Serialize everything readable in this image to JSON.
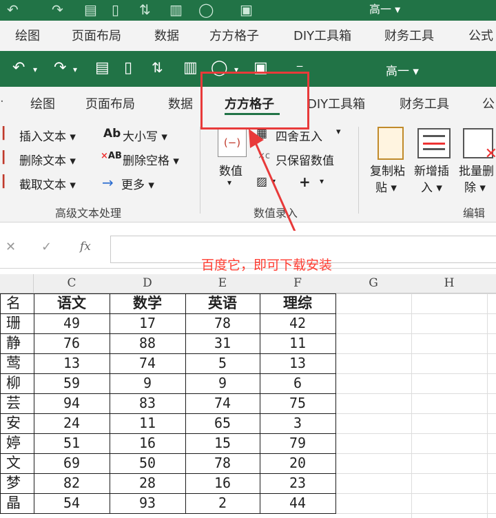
{
  "background_window": {
    "account": "高一 ▾",
    "tabs": [
      "绘图",
      "页面布局",
      "数据",
      "方方格子",
      "DIY工具箱",
      "财务工具",
      "公式"
    ]
  },
  "window": {
    "account": "高一 ▾",
    "tabs": [
      "绘图",
      "页面布局",
      "数据",
      "方方格子",
      "DIY工具箱",
      "财务工具",
      "公"
    ],
    "active_tab_index": 3
  },
  "ribbon": {
    "advanced_text": {
      "buttons": [
        "插入文本 ▾",
        "删除文本 ▾",
        "截取文本 ▾",
        "大小写 ▾",
        "删除空格 ▾",
        "更多 ▾"
      ],
      "label": "高级文本处理"
    },
    "numeric_entry": {
      "value_button": "数值",
      "rounding": "四舍五入",
      "keep_values": "只保留数值",
      "label": "数值录入"
    },
    "edit": {
      "copy_paste": [
        "复制粘",
        "贴 ▾"
      ],
      "add_insert": [
        "新增插",
        "入 ▾"
      ],
      "batch_delete": [
        "批量删",
        "除 ▾"
      ],
      "label": "编辑"
    }
  },
  "formula_bar": {
    "cancel": "✕",
    "confirm": "✓",
    "fx": "fx",
    "value": ""
  },
  "annotation": "百度它，即可下载安装",
  "sheet": {
    "columns": [
      "C",
      "D",
      "E",
      "F",
      "G",
      "H"
    ],
    "header_row": [
      "名",
      "语文",
      "数学",
      "英语",
      "理综"
    ],
    "rows": [
      [
        "珊",
        "49",
        "17",
        "78",
        "42"
      ],
      [
        "静",
        "76",
        "88",
        "31",
        "11"
      ],
      [
        "莺",
        "13",
        "74",
        "5",
        "13"
      ],
      [
        "柳",
        "59",
        "9",
        "9",
        "6"
      ],
      [
        "芸",
        "94",
        "83",
        "74",
        "75"
      ],
      [
        "安琪",
        "24",
        "11",
        "65",
        "3"
      ],
      [
        "婷婷",
        "51",
        "16",
        "15",
        "79"
      ],
      [
        "文秀",
        "69",
        "50",
        "78",
        "20"
      ],
      [
        "梦",
        "82",
        "28",
        "16",
        "23"
      ],
      [
        "晶",
        "54",
        "93",
        "2",
        "44"
      ]
    ]
  },
  "colors": {
    "excel_green": "#217346",
    "annotation_red": "#e83a3a"
  }
}
